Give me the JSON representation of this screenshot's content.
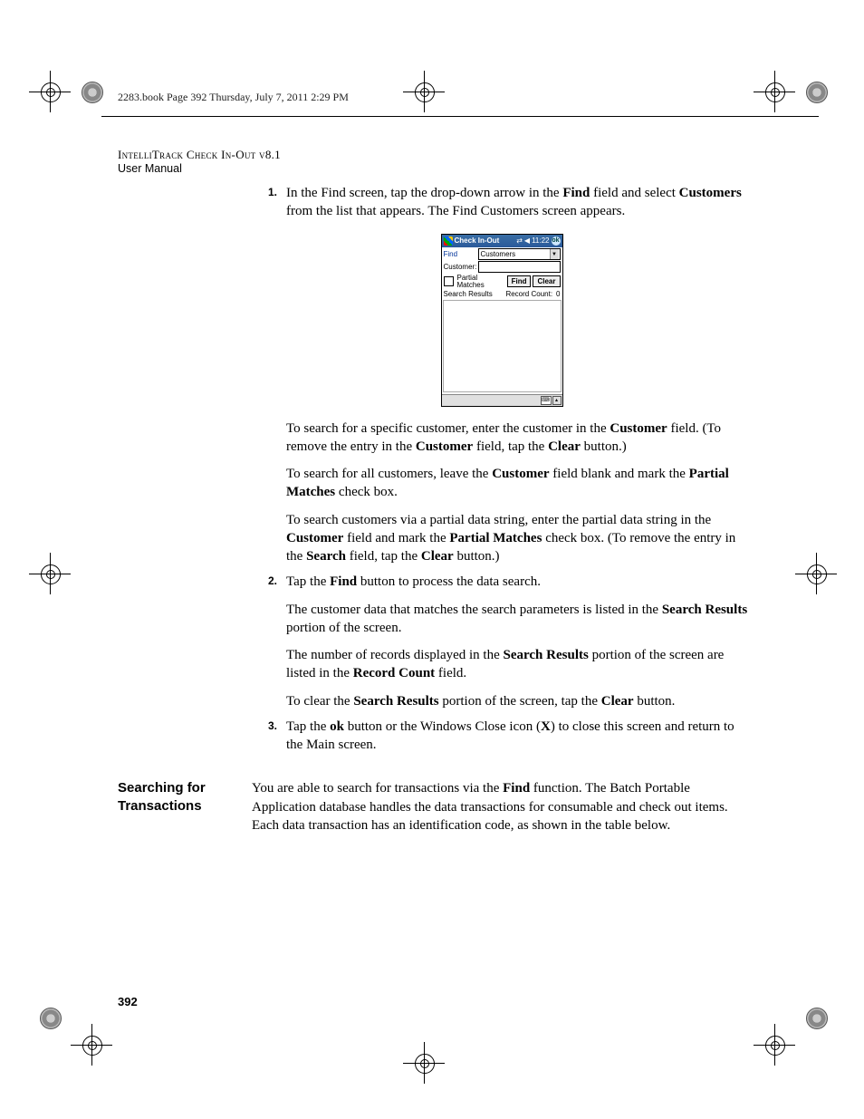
{
  "book_header": "2283.book  Page 392  Thursday, July 7, 2011  2:29 PM",
  "title_line1": "IntelliTrack Check In-Out v8.1",
  "title_line2": "User Manual",
  "step1_num": "1.",
  "step1_html": "In the Find screen, tap the drop-down arrow in the <b>Find</b> field and select <b>Customers</b> from the list that appears. The Find Customers screen appears.",
  "para1_html": "To search for a specific customer, enter the customer in the <b>Customer</b> field. (To remove the entry in the <b>Customer</b> field, tap the <b>Clear</b> button.)",
  "para2_html": "To search for all customers, leave the <b>Customer</b> field blank and mark the <b>Partial Matches</b> check box.",
  "para3_html": "To search customers via a partial data string, enter the partial data string in the <b>Customer</b> field and mark the <b>Partial Matches</b> check box. (To remove the entry in the <b>Search</b> field, tap the <b>Clear</b> button.)",
  "step2_num": "2.",
  "step2_html": "Tap the <b>Find</b> button to process the data search.",
  "para4_html": "The customer data that matches the search parameters is listed in the <b>Search Results</b> portion of the screen.",
  "para5_html": "The number of records displayed in the <b>Search Results</b> portion of the screen are listed in the <b>Record Count</b> field.",
  "para6_html": "To clear the <b>Search Results</b> portion of the screen, tap the <b>Clear</b> button.",
  "step3_num": "3.",
  "step3_html": "Tap the <b>ok</b> button or the Windows Close icon (<b>X</b>) to close this screen and return to the Main screen.",
  "section_heading": "Searching for Transactions",
  "section_body_html": "You are able to search for transactions via the <b>Find</b> function. The Batch Portable Application database handles the data transactions for consumable and check out items. Each data transaction has an identification code, as shown in the table below.",
  "page_number": "392",
  "device": {
    "title": "Check In-Out",
    "time": "11:22",
    "ok": "ok",
    "find_label": "Find",
    "find_value": "Customers",
    "customer_label": "Customer:",
    "partial_label": "Partial Matches",
    "find_btn": "Find",
    "clear_btn": "Clear",
    "results_label": "Search Results",
    "record_count_label": "Record Count:",
    "record_count_value": "0"
  }
}
